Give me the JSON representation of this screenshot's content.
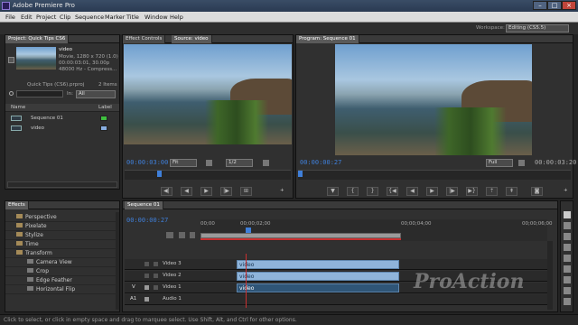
{
  "app": {
    "title": "Adobe Premiere Pro"
  },
  "menu": [
    "File",
    "Edit",
    "Project",
    "Clip",
    "Sequence",
    "Marker",
    "Title",
    "Window",
    "Help"
  ],
  "workspace": {
    "label": "Workspace:",
    "value": "Editing (CS5.5)"
  },
  "project": {
    "tab": "Project: Quick Tips CS6",
    "clip_name": "video",
    "clip_info": [
      "Movie, 1280 x 720 (1.0)",
      "00:00:03:01, 30.00p",
      "48000 Hz - Compress..."
    ],
    "file_name": "Quick Tips (CS6).prproj",
    "items_count": "2 Items",
    "in_label": "In:",
    "in_value": "All",
    "col_name": "Name",
    "col_label": "Label",
    "items": [
      {
        "name": "Sequence 01",
        "color": "#3fbf3f"
      },
      {
        "name": "video",
        "color": "#88aee0"
      }
    ]
  },
  "source": {
    "tabs": [
      "Effect Controls",
      "Source: video"
    ],
    "timecode": "00:00:03:00",
    "fit": "Fit",
    "quality": "1/2"
  },
  "program": {
    "tab": "Program: Sequence 01",
    "timecode": "00:00:00:27",
    "fit": "Full",
    "end_timecode": "00:00:03:20"
  },
  "effects": {
    "tab": "Effects",
    "items": [
      "Perspective",
      "Pixelate",
      "Stylize",
      "Time",
      "Transform",
      "Camera View",
      "Crop",
      "Edge Feather",
      "Horizontal Flip"
    ]
  },
  "timeline": {
    "tab": "Sequence 01",
    "timecode": "00:00:00:27",
    "ruler": [
      "00;00",
      "00;00;02;00",
      "00;00;04;00",
      "00;00;06;00"
    ],
    "tracks": [
      {
        "name": "Video 3",
        "clip": "video"
      },
      {
        "name": "Video 2",
        "clip": "video"
      },
      {
        "name": "Video 1",
        "clip": "video"
      },
      {
        "name": "Audio 1",
        "clip": ""
      }
    ],
    "v_label": "V",
    "a_label": "A1"
  },
  "status": "Click to select, or click in empty space and drag to marquee select. Use Shift, Alt, and Ctrl for other options.",
  "watermark": "ProAction"
}
